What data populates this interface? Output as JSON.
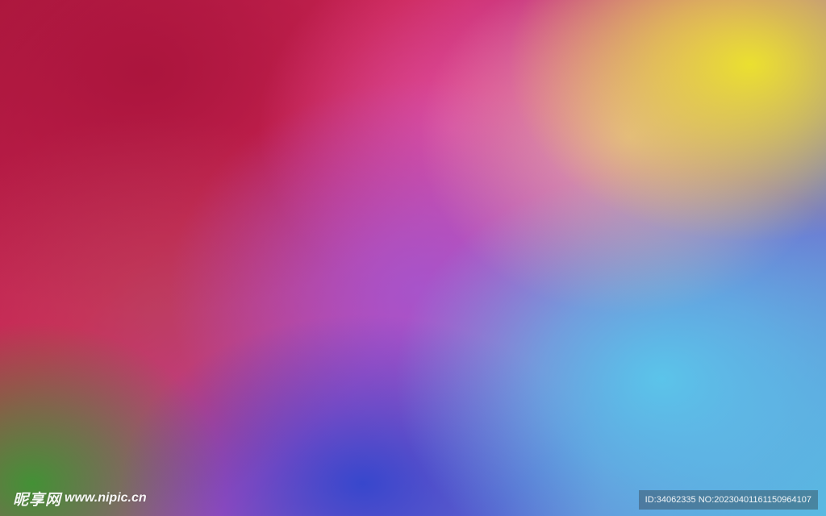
{
  "image": {
    "colors": {
      "top_left": "#b01a40",
      "top_center": "#d0285a",
      "top_right": "#e8e428",
      "center": "#b050c0",
      "right_middle": "#5ac8eb",
      "bottom_center": "#3246cd",
      "bottom_left": "#3c9632",
      "pink_highlight": "#e650a0"
    }
  },
  "watermark": {
    "logo_text": "昵享网",
    "url": "www.nipic.cn"
  },
  "id_bar": {
    "text": "ID:34062335 NO:20230401161150964107"
  }
}
